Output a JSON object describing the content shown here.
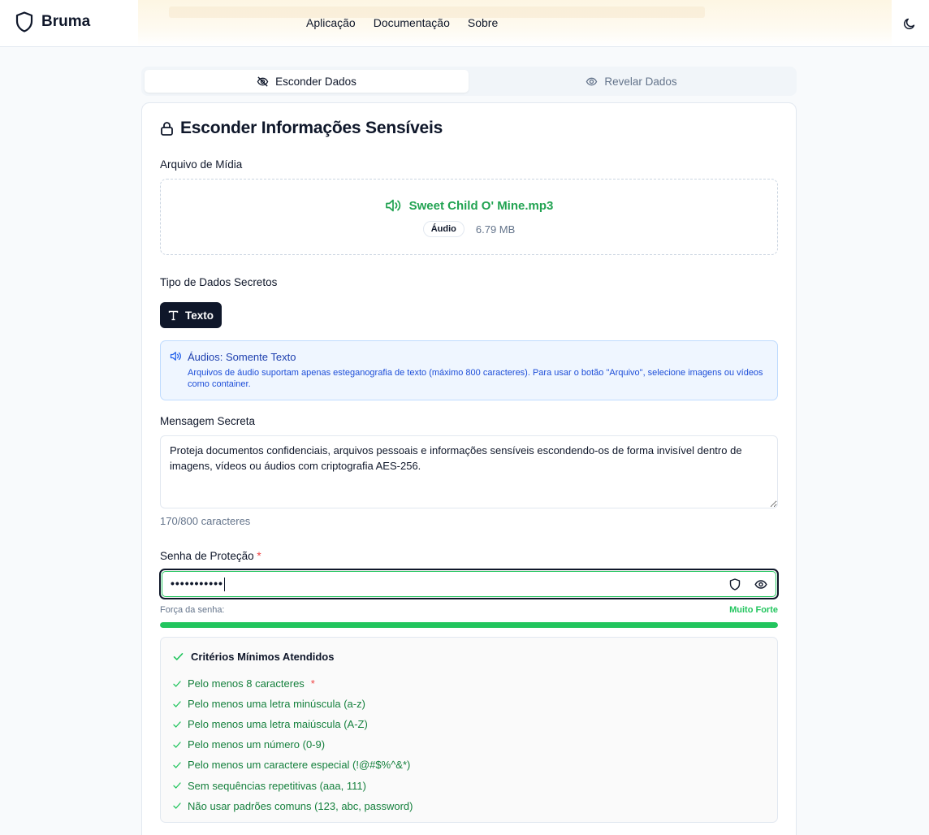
{
  "header": {
    "brand": "Bruma",
    "nav": [
      "Aplicação",
      "Documentação",
      "Sobre"
    ]
  },
  "tabs": [
    {
      "label": "Esconder Dados",
      "active": true
    },
    {
      "label": "Revelar Dados",
      "active": false
    }
  ],
  "card": {
    "title": "Esconder Informações Sensíveis",
    "media": {
      "label": "Arquivo de Mídia",
      "file_name": "Sweet Child O' Mine.mp3",
      "badge": "Áudio",
      "size": "6.79 MB"
    },
    "secret_type": {
      "label": "Tipo de Dados Secretos",
      "button": "Texto"
    },
    "info": {
      "title": "Áudios: Somente Texto",
      "text": "Arquivos de áudio suportam apenas esteganografia de texto (máximo 800 caracteres). Para usar o botão \"Arquivo\", selecione imagens ou vídeos como container."
    },
    "message": {
      "label": "Mensagem Secreta",
      "value": "Proteja documentos confidenciais, arquivos pessoais e informações sensíveis escondendo-os de forma invisível dentro de imagens, vídeos ou áudios com criptografia AES-256.",
      "counter": "170/800 caracteres"
    },
    "password": {
      "label": "Senha de Proteção",
      "required_mark": "*",
      "masked_value": "•••••••••••",
      "strength_label": "Força da senha:",
      "strength_value": "Muito Forte",
      "strength_fraction": 1.0
    },
    "criteria": {
      "title": "Critérios Mínimos Atendidos",
      "items": [
        "Pelo menos 8 caracteres",
        "Pelo menos uma letra minúscula (a-z)",
        "Pelo menos uma letra maiúscula (A-Z)",
        "Pelo menos um número (0-9)",
        "Pelo menos um caractere especial (!@#$%^&*)",
        "Sem sequências repetitivas (aaa, 111)",
        "Não usar padrões comuns (123, abc, password)"
      ]
    }
  },
  "colors": {
    "primary": "#0f172a",
    "success": "#22c55e",
    "info_bg": "#eff6ff",
    "info_text": "#1e40af"
  },
  "icons": {
    "brand": "shield-icon",
    "theme": "moon-icon",
    "hide_tab": "eye-off-icon",
    "reveal_tab": "eye-icon",
    "title": "lock-icon",
    "media": "volume-icon",
    "text_type": "type-icon",
    "info": "volume-icon",
    "password_generate": "shield-icon",
    "password_toggle": "eye-icon",
    "criteria": "check-icon"
  }
}
